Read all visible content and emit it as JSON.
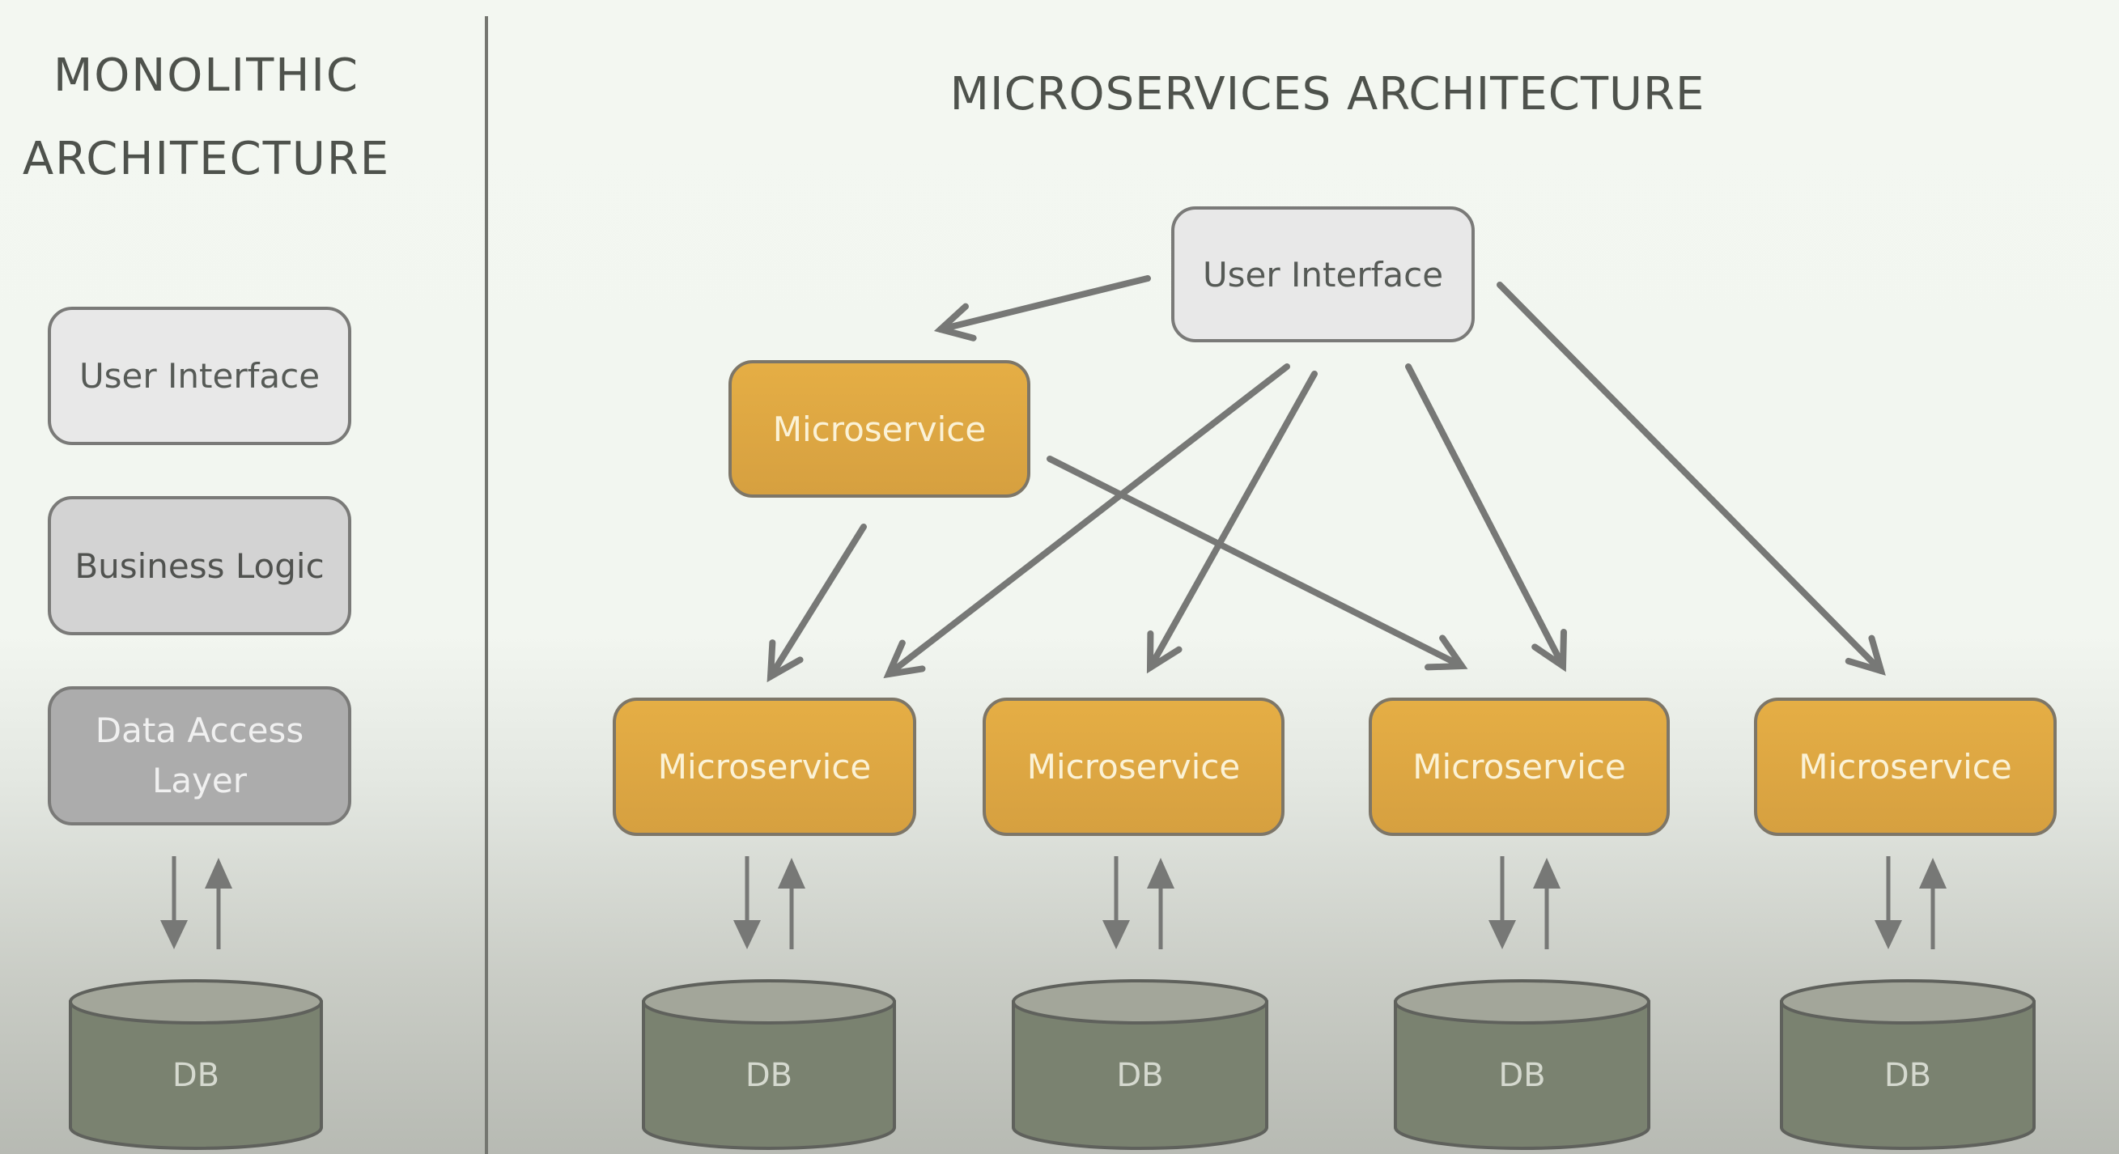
{
  "monolithic": {
    "title_line1": "MONOLITHIC",
    "title_line2": "ARCHITECTURE",
    "layers": [
      {
        "label": "User Interface"
      },
      {
        "label": "Business Logic"
      },
      {
        "label_line1": "Data Access",
        "label_line2": "Layer"
      }
    ],
    "database": {
      "label": "DB"
    }
  },
  "microservices": {
    "title": "MICROSERVICES ARCHITECTURE",
    "user_interface": {
      "label": "User Interface"
    },
    "middle_service": {
      "label": "Microservice"
    },
    "services": [
      {
        "label": "Microservice",
        "db_label": "DB"
      },
      {
        "label": "Microservice",
        "db_label": "DB"
      },
      {
        "label": "Microservice",
        "db_label": "DB"
      },
      {
        "label": "Microservice",
        "db_label": "DB"
      }
    ],
    "connections": [
      {
        "from": "user_interface",
        "to": "middle_service"
      },
      {
        "from": "user_interface",
        "to": "services.0"
      },
      {
        "from": "user_interface",
        "to": "services.1"
      },
      {
        "from": "user_interface",
        "to": "services.2"
      },
      {
        "from": "user_interface",
        "to": "services.3"
      },
      {
        "from": "middle_service",
        "to": "services.0"
      },
      {
        "from": "middle_service",
        "to": "services.2"
      }
    ]
  },
  "colors": {
    "microservice_fill": "#e0a944",
    "ui_fill": "#e8e8e8",
    "business_logic_fill": "#d3d3d3",
    "data_access_fill": "#acacac",
    "db_body": "#7a8270",
    "db_top": "#a3a69a",
    "arrow": "#777876"
  }
}
